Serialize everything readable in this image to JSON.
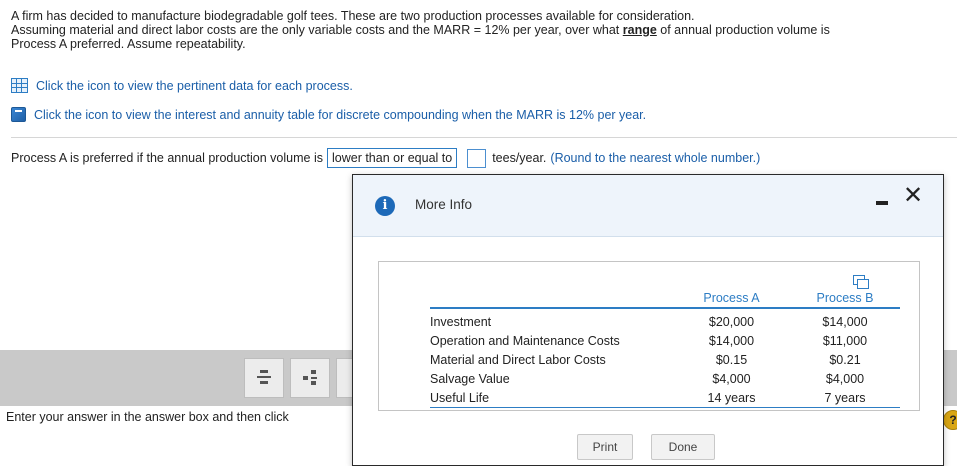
{
  "question": {
    "line1": "A firm has decided to manufacture biodegradable golf tees. These are two production processes available for consideration.",
    "line2_before": "Assuming material and direct labor costs are the only variable costs and the MARR = 12% per year, over what ",
    "line2_range": "range",
    "line2_after": " of annual production volume is",
    "line3": "Process A preferred. Assume repeatability."
  },
  "links": {
    "data_link": "Click the icon to view the pertinent data for each process.",
    "table_link": "Click the icon to view the interest and annuity table for discrete compounding when the MARR is 12% per year."
  },
  "answer": {
    "prefix": "Process A is preferred if the annual production volume is",
    "dropdown_value": "lower than or equal to",
    "input_value": "",
    "suffix": "tees/year.",
    "note": "(Round to the nearest whole number.)"
  },
  "bottom": {
    "instruction": "Enter your answer in the answer box and then click",
    "help": "?"
  },
  "modal": {
    "title": "More Info",
    "info_glyph": "i",
    "close_glyph": "✕",
    "headers": [
      "Process A",
      "Process B"
    ],
    "rows": [
      {
        "label": "Investment",
        "a": "$20,000",
        "b": "$14,000"
      },
      {
        "label": "Operation and Maintenance Costs",
        "a": "$14,000",
        "b": "$11,000"
      },
      {
        "label": "Material and Direct Labor Costs",
        "a": "$0.15",
        "b": "$0.21"
      },
      {
        "label": "Salvage Value",
        "a": "$4,000",
        "b": "$4,000"
      },
      {
        "label": "Useful Life",
        "a": "14 years",
        "b": "7 years"
      }
    ],
    "print_label": "Print",
    "done_label": "Done"
  },
  "colors": {
    "link_blue": "#1a5ea8",
    "accent_blue": "#2d7dc4",
    "header_bg": "#eef4fb",
    "band_gray": "#c9c9c9"
  }
}
